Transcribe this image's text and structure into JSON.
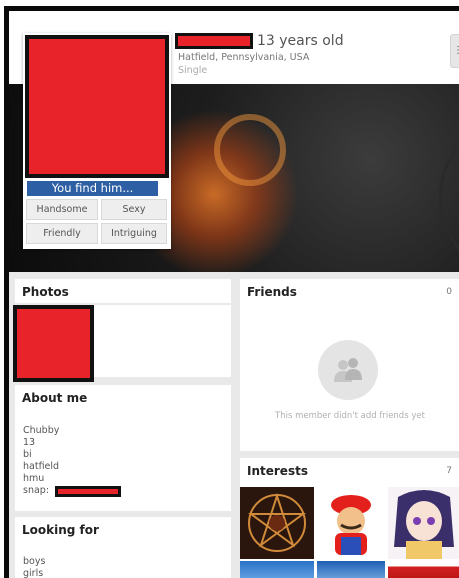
{
  "profile": {
    "age_text": "13 years old",
    "location": "Hatfield, Pennsylvania, USA",
    "status": "Single"
  },
  "avatar_card": {
    "find_prompt": "You find him...",
    "vote_options": [
      "Handsome",
      "Sexy",
      "Friendly",
      "Intriguing"
    ]
  },
  "photos": {
    "title": "Photos"
  },
  "about": {
    "title": "About me",
    "lines": [
      "Chubby",
      "13",
      "bi",
      "hatfield",
      "hmu",
      "snap:"
    ]
  },
  "looking_for": {
    "title": "Looking for",
    "lines": [
      "boys",
      "girls"
    ]
  },
  "friends": {
    "title": "Friends",
    "count": "0",
    "empty_message": "This member didn't add friends yet"
  },
  "interests": {
    "title": "Interests",
    "count": "7"
  },
  "colors": {
    "redaction": "#e8232a",
    "find_bar": "#2c5fa3"
  }
}
